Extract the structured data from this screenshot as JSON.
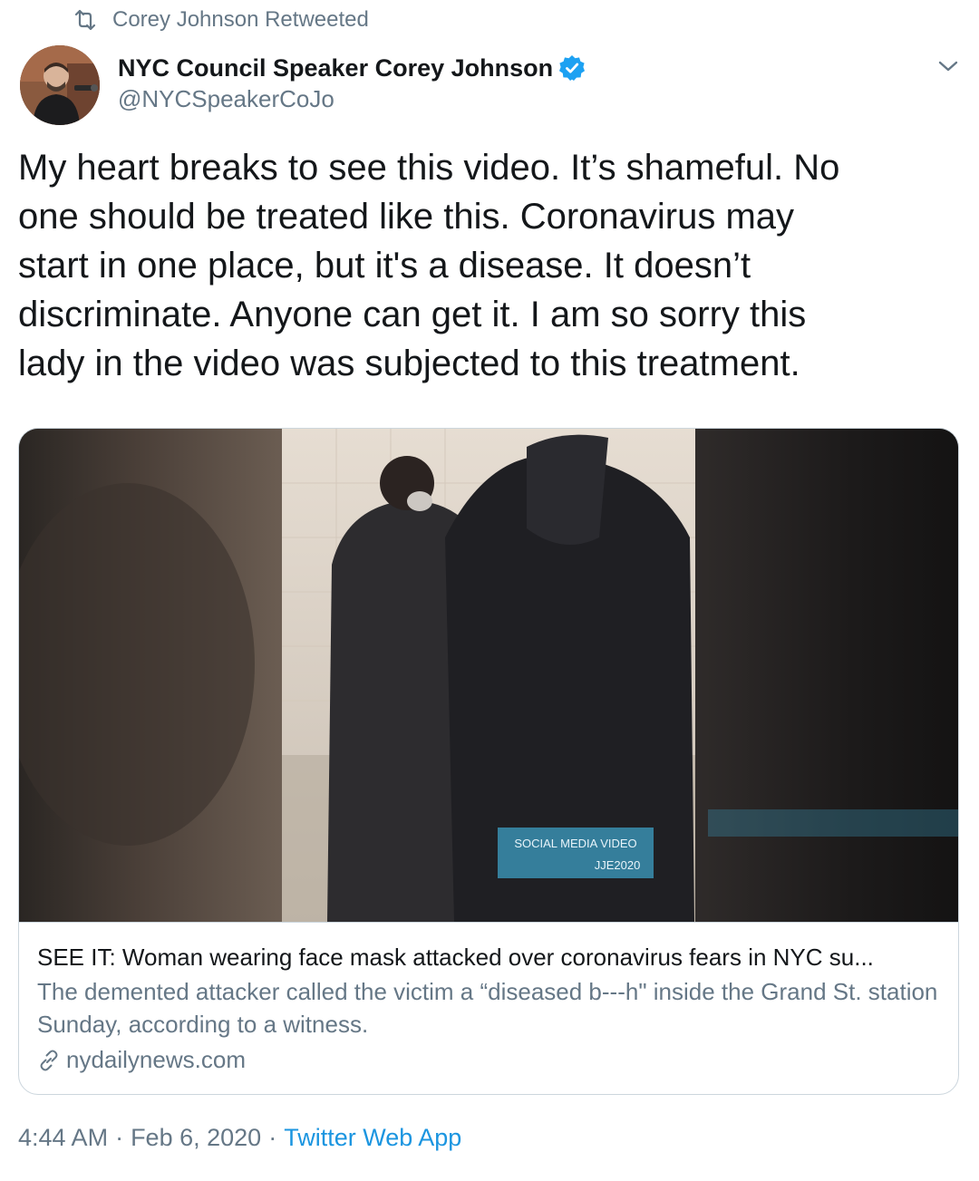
{
  "retweet": {
    "label": "Corey Johnson Retweeted",
    "icon": "retweet-icon"
  },
  "author": {
    "display_name": "NYC Council Speaker Corey Johnson",
    "handle": "@NYCSpeakerCoJo",
    "verified": true,
    "verified_color": "#1da1f2"
  },
  "tweet": {
    "text": "My heart breaks to see this video. It’s shameful. No\none should be treated like this. Coronavirus may\nstart in one place, but it's a disease. It doesn’t\ndiscriminate. Anyone can get it. I am so sorry this\nlady in the video was subjected to this treatment."
  },
  "card": {
    "title": "SEE IT: Woman wearing face mask attacked over coronavirus fears in NYC su...",
    "description": "The demented attacker called the victim a “diseased b---h\" inside the Grand St. station Sunday, according to a witness.",
    "domain": "nydailynews.com",
    "media_watermark": {
      "line1": "SOCIAL MEDIA VIDEO",
      "line2": "JJE2020"
    }
  },
  "meta": {
    "time": "4:44 AM",
    "separator": "·",
    "date": "Feb 6, 2020",
    "source": "Twitter Web App",
    "link_color": "#1b95e0"
  }
}
